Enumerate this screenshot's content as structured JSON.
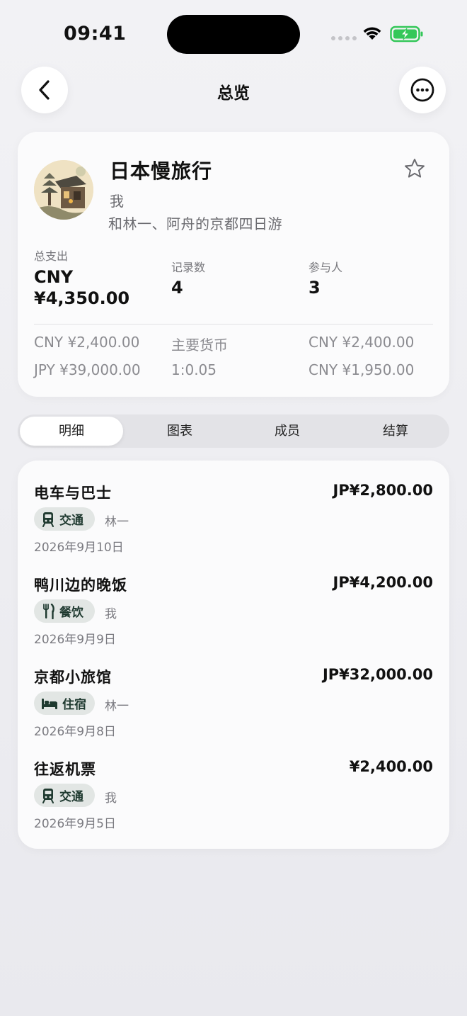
{
  "status": {
    "time": "09:41"
  },
  "nav": {
    "title": "总览"
  },
  "trip": {
    "name": "日本慢旅行",
    "owner": "我",
    "description": "和林一、阿舟的京都四日游"
  },
  "stats": {
    "total_label": "总支出",
    "total_currency": "CNY",
    "total_amount": "¥4,350.00",
    "records_label": "记录数",
    "records_value": "4",
    "members_label": "参与人",
    "members_value": "3"
  },
  "currencies": {
    "row1_left": "CNY ¥2,400.00",
    "row1_mid": "主要货币",
    "row1_right": "CNY ¥2,400.00",
    "row2_left": "JPY ¥39,000.00",
    "row2_mid": "1:0.05",
    "row2_right": "CNY ¥1,950.00"
  },
  "tabs": [
    {
      "label": "明细",
      "active": true
    },
    {
      "label": "图表",
      "active": false
    },
    {
      "label": "成员",
      "active": false
    },
    {
      "label": "结算",
      "active": false
    }
  ],
  "expenses": [
    {
      "title": "电车与巴士",
      "amount": "JP¥2,800.00",
      "category": "交通",
      "icon": "train-icon",
      "payer": "林一",
      "date": "2026年9月10日"
    },
    {
      "title": "鸭川边的晚饭",
      "amount": "JP¥4,200.00",
      "category": "餐饮",
      "icon": "fork-knife-icon",
      "payer": "我",
      "date": "2026年9月9日"
    },
    {
      "title": "京都小旅馆",
      "amount": "JP¥32,000.00",
      "category": "住宿",
      "icon": "bed-icon",
      "payer": "林一",
      "date": "2026年9月8日"
    },
    {
      "title": "往返机票",
      "amount": "¥2,400.00",
      "category": "交通",
      "icon": "train-icon",
      "payer": "我",
      "date": "2026年9月5日"
    }
  ],
  "colors": {
    "chip_bg": "#e2e6e4",
    "chip_text": "#1f3a30",
    "battery_green": "#34c759"
  }
}
